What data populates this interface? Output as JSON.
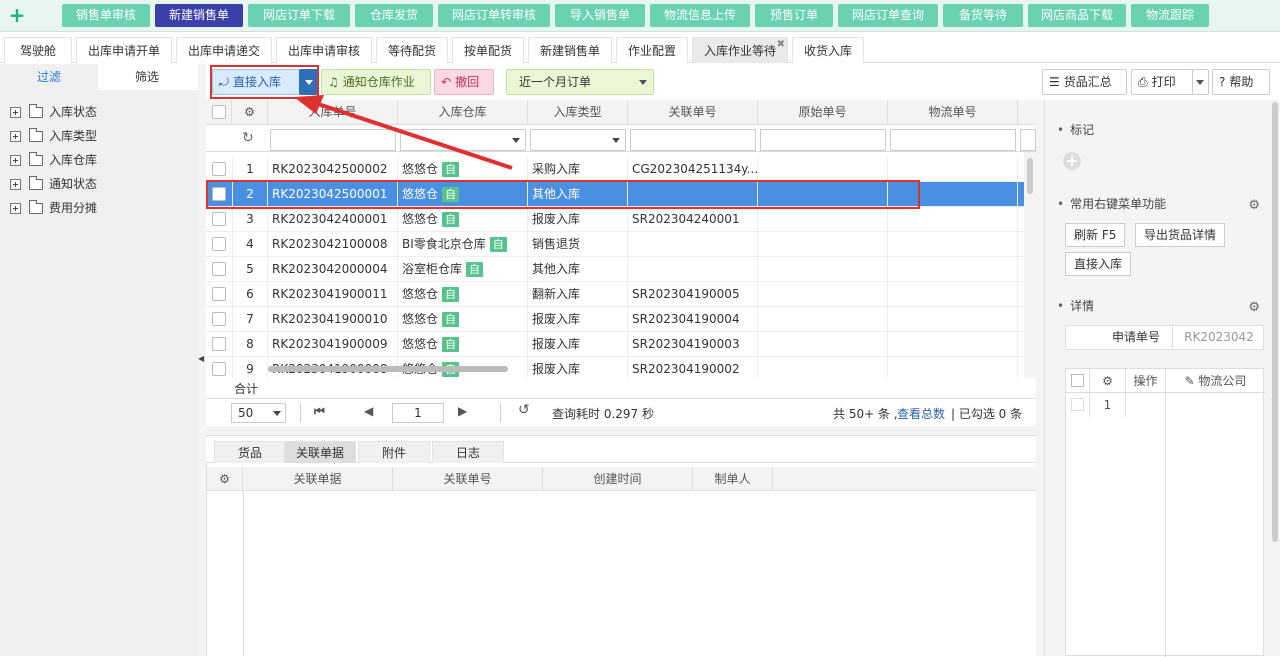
{
  "topnav": {
    "plus_label": "+",
    "items": [
      "销售单审核",
      "新建销售单",
      "网店订单下载",
      "仓库发货",
      "网店订单转审核",
      "导入销售单",
      "物流信息上传",
      "预售订单",
      "网店订单查询",
      "备货等待",
      "网店商品下载",
      "物流跟踪"
    ],
    "active_index": 1
  },
  "tabs": {
    "items": [
      "驾驶舱",
      "出库申请开单",
      "出库申请递交",
      "出库申请审核",
      "等待配货",
      "按单配货",
      "新建销售单",
      "作业配置",
      "入库作业等待",
      "收货入库"
    ],
    "active_index": 8,
    "close_glyph": "✖"
  },
  "left": {
    "tab_filter": "过滤",
    "tab_select": "筛选",
    "tree": [
      "入库状态",
      "入库类型",
      "入库仓库",
      "通知状态",
      "费用分摊"
    ]
  },
  "toolbar": {
    "direct_in": "直接入库",
    "notify": "通知仓库作业",
    "revoke": "撤回",
    "period": "近一个月订单",
    "summary": "货品汇总",
    "print": "打印",
    "help": "帮助"
  },
  "grid": {
    "headers": [
      "入库单号",
      "入库仓库",
      "入库类型",
      "关联单号",
      "原始单号",
      "物流单号"
    ],
    "auto_badge": "自",
    "rows": [
      {
        "idx": "1",
        "no": "RK2023042500002",
        "wh": "悠悠仓",
        "auto": true,
        "type": "采购入库",
        "rel": "CG202304251134y..."
      },
      {
        "idx": "2",
        "no": "RK2023042500001",
        "wh": "悠悠仓",
        "auto": true,
        "type": "其他入库",
        "rel": ""
      },
      {
        "idx": "3",
        "no": "RK2023042400001",
        "wh": "悠悠仓",
        "auto": true,
        "type": "报废入库",
        "rel": "SR202304240001"
      },
      {
        "idx": "4",
        "no": "RK2023042100008",
        "wh": "BI零食北京仓库",
        "auto": true,
        "type": "销售退货",
        "rel": ""
      },
      {
        "idx": "5",
        "no": "RK2023042000004",
        "wh": "浴室柜仓库",
        "auto": true,
        "type": "其他入库",
        "rel": ""
      },
      {
        "idx": "6",
        "no": "RK2023041900011",
        "wh": "悠悠仓",
        "auto": true,
        "type": "翻新入库",
        "rel": "SR202304190005"
      },
      {
        "idx": "7",
        "no": "RK2023041900010",
        "wh": "悠悠仓",
        "auto": true,
        "type": "报废入库",
        "rel": "SR202304190004"
      },
      {
        "idx": "8",
        "no": "RK2023041900009",
        "wh": "悠悠仓",
        "auto": true,
        "type": "报废入库",
        "rel": "SR202304190003"
      },
      {
        "idx": "9",
        "no": "RK2023041900008",
        "wh": "悠悠仓",
        "auto": true,
        "type": "报废入库",
        "rel": "SR202304190002"
      }
    ],
    "selected_index": 1,
    "total_label": "合计"
  },
  "pager": {
    "page_size": "50",
    "page": "1",
    "query_time": "查询耗时 0.297 秒",
    "total_prefix": "共 50+ 条 ,",
    "view_total": "查看总数",
    "checked": "| 已勾选 0 条"
  },
  "bottom": {
    "tabs": [
      "货品",
      "关联单据",
      "附件",
      "日志"
    ],
    "active_index": 1,
    "headers": [
      "关联单据",
      "关联单号",
      "创建时间",
      "制单人"
    ]
  },
  "right": {
    "mark_title": "标记",
    "menu_title": "常用右键菜单功能",
    "refresh_btn": "刷新  F5",
    "export_btn": "导出货品详情",
    "direct_btn": "直接入库",
    "detail_title": "详情",
    "apply_no_label": "申请单号",
    "apply_no_value": "RK2023042",
    "op_header": "操作",
    "logistics_header": "物流公司",
    "row_idx": "1"
  },
  "colors": {
    "accent": "#6ad2b0",
    "active_nav": "#3b3fa8",
    "selection": "#4a90e2",
    "annotation": "#e03030"
  }
}
